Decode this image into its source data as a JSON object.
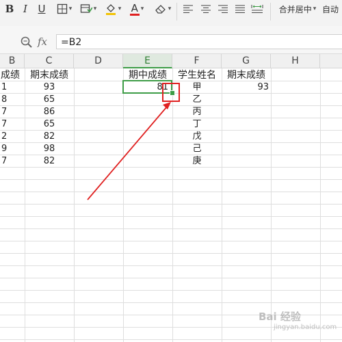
{
  "toolbar": {
    "bold_label": "B",
    "italic_label": "I",
    "underline_label": "U",
    "font_color_label": "A",
    "merge_center_label": "合并居中",
    "auto_wrap_label": "自动",
    "icons": [
      "border-icon",
      "cell-style-icon",
      "fill-color-icon",
      "font-color-icon",
      "eraser-icon",
      "align-left-icon",
      "align-center-icon",
      "align-right-icon",
      "justify-icon",
      "distribute-icon"
    ],
    "font_color": "#e02020",
    "fill_color": "#f2c200"
  },
  "formula_bar": {
    "fx_label": "fx",
    "formula": "=B2"
  },
  "columns": [
    "B",
    "C",
    "D",
    "E",
    "F",
    "G",
    "H"
  ],
  "active_column": "E",
  "headers": {
    "B": "成绩",
    "C": "期末成绩",
    "E": "期中成绩",
    "F": "学生姓名",
    "G": "期末成绩"
  },
  "rows": [
    {
      "B": "1",
      "C": "93",
      "E": "81",
      "F": "甲",
      "G": "93"
    },
    {
      "B": "8",
      "C": "65",
      "E": "",
      "F": "乙",
      "G": ""
    },
    {
      "B": "7",
      "C": "86",
      "E": "",
      "F": "丙",
      "G": ""
    },
    {
      "B": "7",
      "C": "65",
      "E": "",
      "F": "丁",
      "G": ""
    },
    {
      "B": "2",
      "C": "82",
      "E": "",
      "F": "戊",
      "G": ""
    },
    {
      "B": "9",
      "C": "98",
      "E": "",
      "F": "己",
      "G": ""
    },
    {
      "B": "7",
      "C": "82",
      "E": "",
      "F": "庚",
      "G": ""
    }
  ],
  "accent_green": "#3d9c46",
  "annotation_red": "#e02020",
  "watermark": {
    "text": "Bai 经验",
    "subtext": "jingyan.baidu.com"
  }
}
